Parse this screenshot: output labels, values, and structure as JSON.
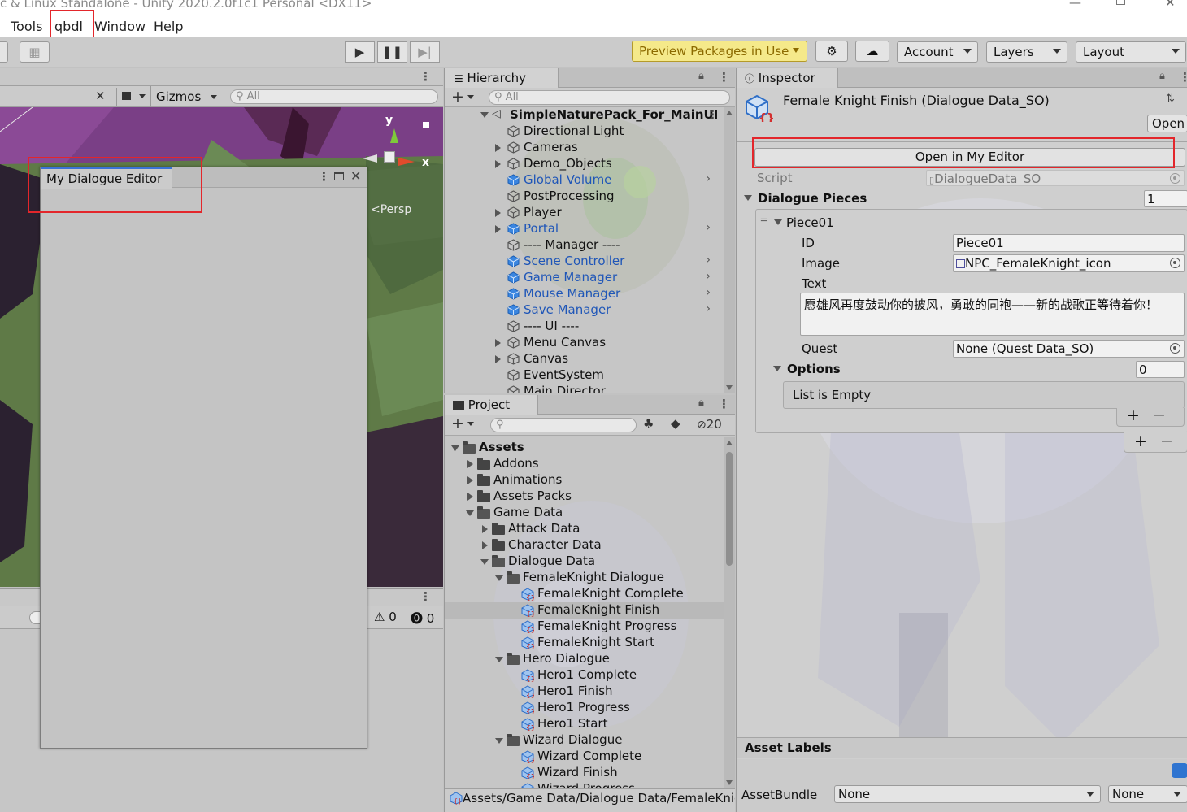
{
  "window": {
    "title": "c & Linux Standalone - Unity 2020.2.0f1c1 Personal <DX11>"
  },
  "menu": {
    "items": [
      "Tools",
      "qbdl",
      "Window",
      "Help"
    ]
  },
  "toolbar": {
    "preview_packages": "Preview Packages in Use",
    "account": "Account",
    "layers": "Layers",
    "layout": "Layout"
  },
  "scene": {
    "gizmos": "Gizmos",
    "search_placeholder": "All",
    "persp_label": "Persp",
    "gizmo_y": "y",
    "gizmo_x": "x"
  },
  "console": {
    "warning_count": "0",
    "error_count": "0"
  },
  "dialogue_editor": {
    "tab_title": "My Dialogue Editor"
  },
  "hierarchy": {
    "tab": "Hierarchy",
    "search_placeholder": "All",
    "scene_name": "SimpleNaturePack_For_MainUI",
    "rows": [
      {
        "label": "Directional Light",
        "arrow": false,
        "blue": false,
        "chev": false
      },
      {
        "label": "Cameras",
        "arrow": true,
        "blue": false,
        "chev": false
      },
      {
        "label": "Demo_Objects",
        "arrow": true,
        "blue": false,
        "chev": false
      },
      {
        "label": "Global Volume",
        "arrow": false,
        "blue": true,
        "chev": true
      },
      {
        "label": "PostProcessing",
        "arrow": false,
        "blue": false,
        "chev": false
      },
      {
        "label": "Player",
        "arrow": true,
        "blue": false,
        "chev": false
      },
      {
        "label": "Portal",
        "arrow": true,
        "blue": true,
        "chev": true
      },
      {
        "label": "---- Manager ----",
        "arrow": false,
        "blue": false,
        "chev": false
      },
      {
        "label": "Scene Controller",
        "arrow": false,
        "blue": true,
        "chev": true
      },
      {
        "label": "Game Manager",
        "arrow": false,
        "blue": true,
        "chev": true
      },
      {
        "label": "Mouse Manager",
        "arrow": false,
        "blue": true,
        "chev": true
      },
      {
        "label": "Save Manager",
        "arrow": false,
        "blue": true,
        "chev": true
      },
      {
        "label": "---- UI ----",
        "arrow": false,
        "blue": false,
        "chev": false
      },
      {
        "label": "Menu Canvas",
        "arrow": true,
        "blue": false,
        "chev": false
      },
      {
        "label": "Canvas",
        "arrow": true,
        "blue": false,
        "chev": false
      },
      {
        "label": "EventSystem",
        "arrow": false,
        "blue": false,
        "chev": false
      },
      {
        "label": "Main Director",
        "arrow": false,
        "blue": false,
        "chev": false
      }
    ]
  },
  "project": {
    "tab": "Project",
    "hidden_count": "20",
    "path": "Assets/Game Data/Dialogue Data/FemaleKnic",
    "rows": [
      {
        "label": "Assets",
        "kind": "folder",
        "depth": 0,
        "open": true,
        "bold": true,
        "selected": false
      },
      {
        "label": "Addons",
        "kind": "folder",
        "depth": 1,
        "open": false,
        "bold": false,
        "selected": false
      },
      {
        "label": "Animations",
        "kind": "folder",
        "depth": 1,
        "open": false,
        "bold": false,
        "selected": false
      },
      {
        "label": "Assets Packs",
        "kind": "folder",
        "depth": 1,
        "open": false,
        "bold": false,
        "selected": false
      },
      {
        "label": "Game Data",
        "kind": "folder",
        "depth": 1,
        "open": true,
        "bold": false,
        "selected": false
      },
      {
        "label": "Attack Data",
        "kind": "folder",
        "depth": 2,
        "open": false,
        "bold": false,
        "selected": false
      },
      {
        "label": "Character Data",
        "kind": "folder",
        "depth": 2,
        "open": false,
        "bold": false,
        "selected": false
      },
      {
        "label": "Dialogue Data",
        "kind": "folder",
        "depth": 2,
        "open": true,
        "bold": false,
        "selected": false
      },
      {
        "label": "FemaleKnight Dialogue",
        "kind": "folder",
        "depth": 3,
        "open": true,
        "bold": false,
        "selected": false
      },
      {
        "label": "FemaleKnight Complete",
        "kind": "so",
        "depth": 4,
        "open": false,
        "bold": false,
        "selected": false
      },
      {
        "label": "FemaleKnight Finish",
        "kind": "so",
        "depth": 4,
        "open": false,
        "bold": false,
        "selected": true
      },
      {
        "label": "FemaleKnight Progress",
        "kind": "so",
        "depth": 4,
        "open": false,
        "bold": false,
        "selected": false
      },
      {
        "label": "FemaleKnight Start",
        "kind": "so",
        "depth": 4,
        "open": false,
        "bold": false,
        "selected": false
      },
      {
        "label": "Hero Dialogue",
        "kind": "folder",
        "depth": 3,
        "open": true,
        "bold": false,
        "selected": false
      },
      {
        "label": "Hero1 Complete",
        "kind": "so",
        "depth": 4,
        "open": false,
        "bold": false,
        "selected": false
      },
      {
        "label": "Hero1 Finish",
        "kind": "so",
        "depth": 4,
        "open": false,
        "bold": false,
        "selected": false
      },
      {
        "label": "Hero1 Progress",
        "kind": "so",
        "depth": 4,
        "open": false,
        "bold": false,
        "selected": false
      },
      {
        "label": "Hero1 Start",
        "kind": "so",
        "depth": 4,
        "open": false,
        "bold": false,
        "selected": false
      },
      {
        "label": "Wizard Dialogue",
        "kind": "folder",
        "depth": 3,
        "open": true,
        "bold": false,
        "selected": false
      },
      {
        "label": "Wizard Complete",
        "kind": "so",
        "depth": 4,
        "open": false,
        "bold": false,
        "selected": false
      },
      {
        "label": "Wizard Finish",
        "kind": "so",
        "depth": 4,
        "open": false,
        "bold": false,
        "selected": false
      },
      {
        "label": "Wizard Progress",
        "kind": "so",
        "depth": 4,
        "open": false,
        "bold": false,
        "selected": false
      }
    ]
  },
  "inspector": {
    "tab": "Inspector",
    "object_title": "Female Knight Finish (Dialogue Data_SO)",
    "open_button": "Open",
    "open_in_editor": "Open in My Editor",
    "script_label": "Script",
    "script_value": "DialogueData_SO",
    "dialogue_pieces_label": "Dialogue Pieces",
    "dialogue_pieces_count": "1",
    "piece_label": "Piece01",
    "id_label": "ID",
    "id_value": "Piece01",
    "image_label": "Image",
    "image_value": "NPC_FemaleKnight_icon",
    "text_label": "Text",
    "text_value": "愿雄风再度鼓动你的披风，勇敢的同袍——新的战歌正等待着你！",
    "quest_label": "Quest",
    "quest_value": "None (Quest Data_SO)",
    "options_label": "Options",
    "options_count": "0",
    "list_empty": "List is Empty",
    "plus": "+",
    "minus": "−",
    "asset_labels": "Asset Labels",
    "asset_bundle_label": "AssetBundle",
    "asset_bundle_value": "None",
    "asset_variant_value": "None"
  },
  "colors": {
    "highlight_red": "#e3262b",
    "link_blue": "#1f56b8",
    "preview_yellow": "#f5e98a"
  }
}
